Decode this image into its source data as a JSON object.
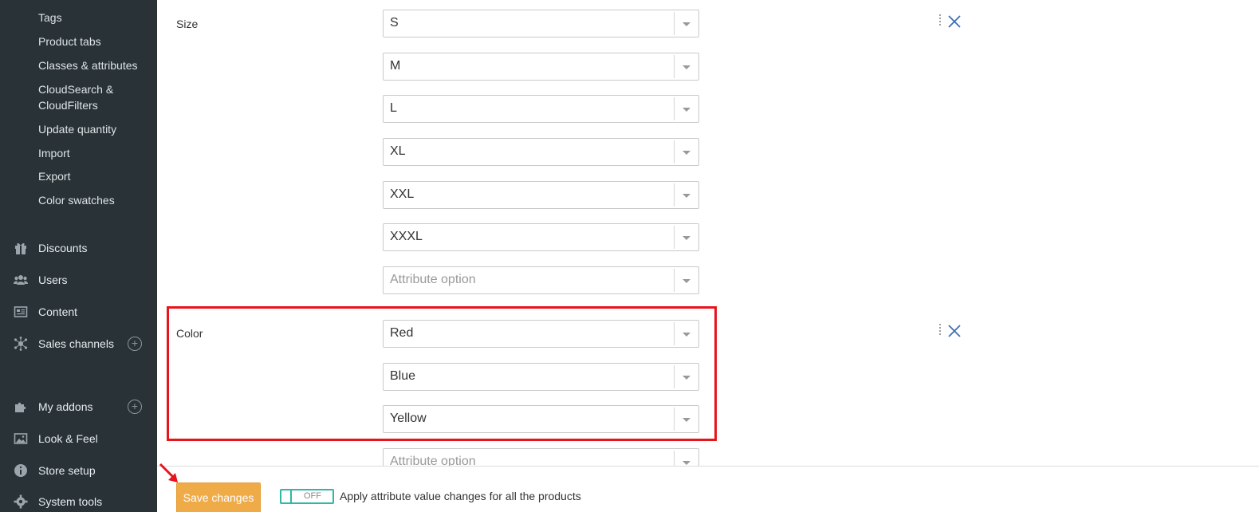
{
  "sidebar": {
    "sub_items": [
      "Tags",
      "Product tabs",
      "Classes & attributes",
      "CloudSearch &",
      "CloudFilters",
      "Update quantity",
      "Import",
      "Export",
      "Color swatches"
    ],
    "main_items": [
      {
        "label": "Discounts",
        "icon": "gift-icon"
      },
      {
        "label": "Users",
        "icon": "users-icon"
      },
      {
        "label": "Content",
        "icon": "newspaper-icon"
      },
      {
        "label": "Sales channels",
        "icon": "network-icon",
        "expandable": true
      },
      {
        "label": "My addons",
        "icon": "puzzle-icon",
        "expandable": true
      },
      {
        "label": "Look & Feel",
        "icon": "image-icon"
      },
      {
        "label": "Store setup",
        "icon": "info-icon"
      },
      {
        "label": "System tools",
        "icon": "gear-icon"
      }
    ]
  },
  "attributes": [
    {
      "name": "Size",
      "options": [
        "S",
        "M",
        "L",
        "XL",
        "XXL",
        "XXXL"
      ],
      "placeholder": "Attribute option"
    },
    {
      "name": "Color",
      "options": [
        "Red",
        "Blue",
        "Yellow"
      ],
      "placeholder": "Attribute option"
    }
  ],
  "bottom_bar": {
    "save_label": "Save changes",
    "toggle_state": "OFF",
    "apply_label": "Apply attribute value changes for all the products"
  },
  "colors": {
    "sidebar_bg": "#283237",
    "save_button": "#f0ab49",
    "toggle_accent": "#2eb8a6",
    "highlight": "#e8141c",
    "remove_icon": "#3c6fb4"
  }
}
